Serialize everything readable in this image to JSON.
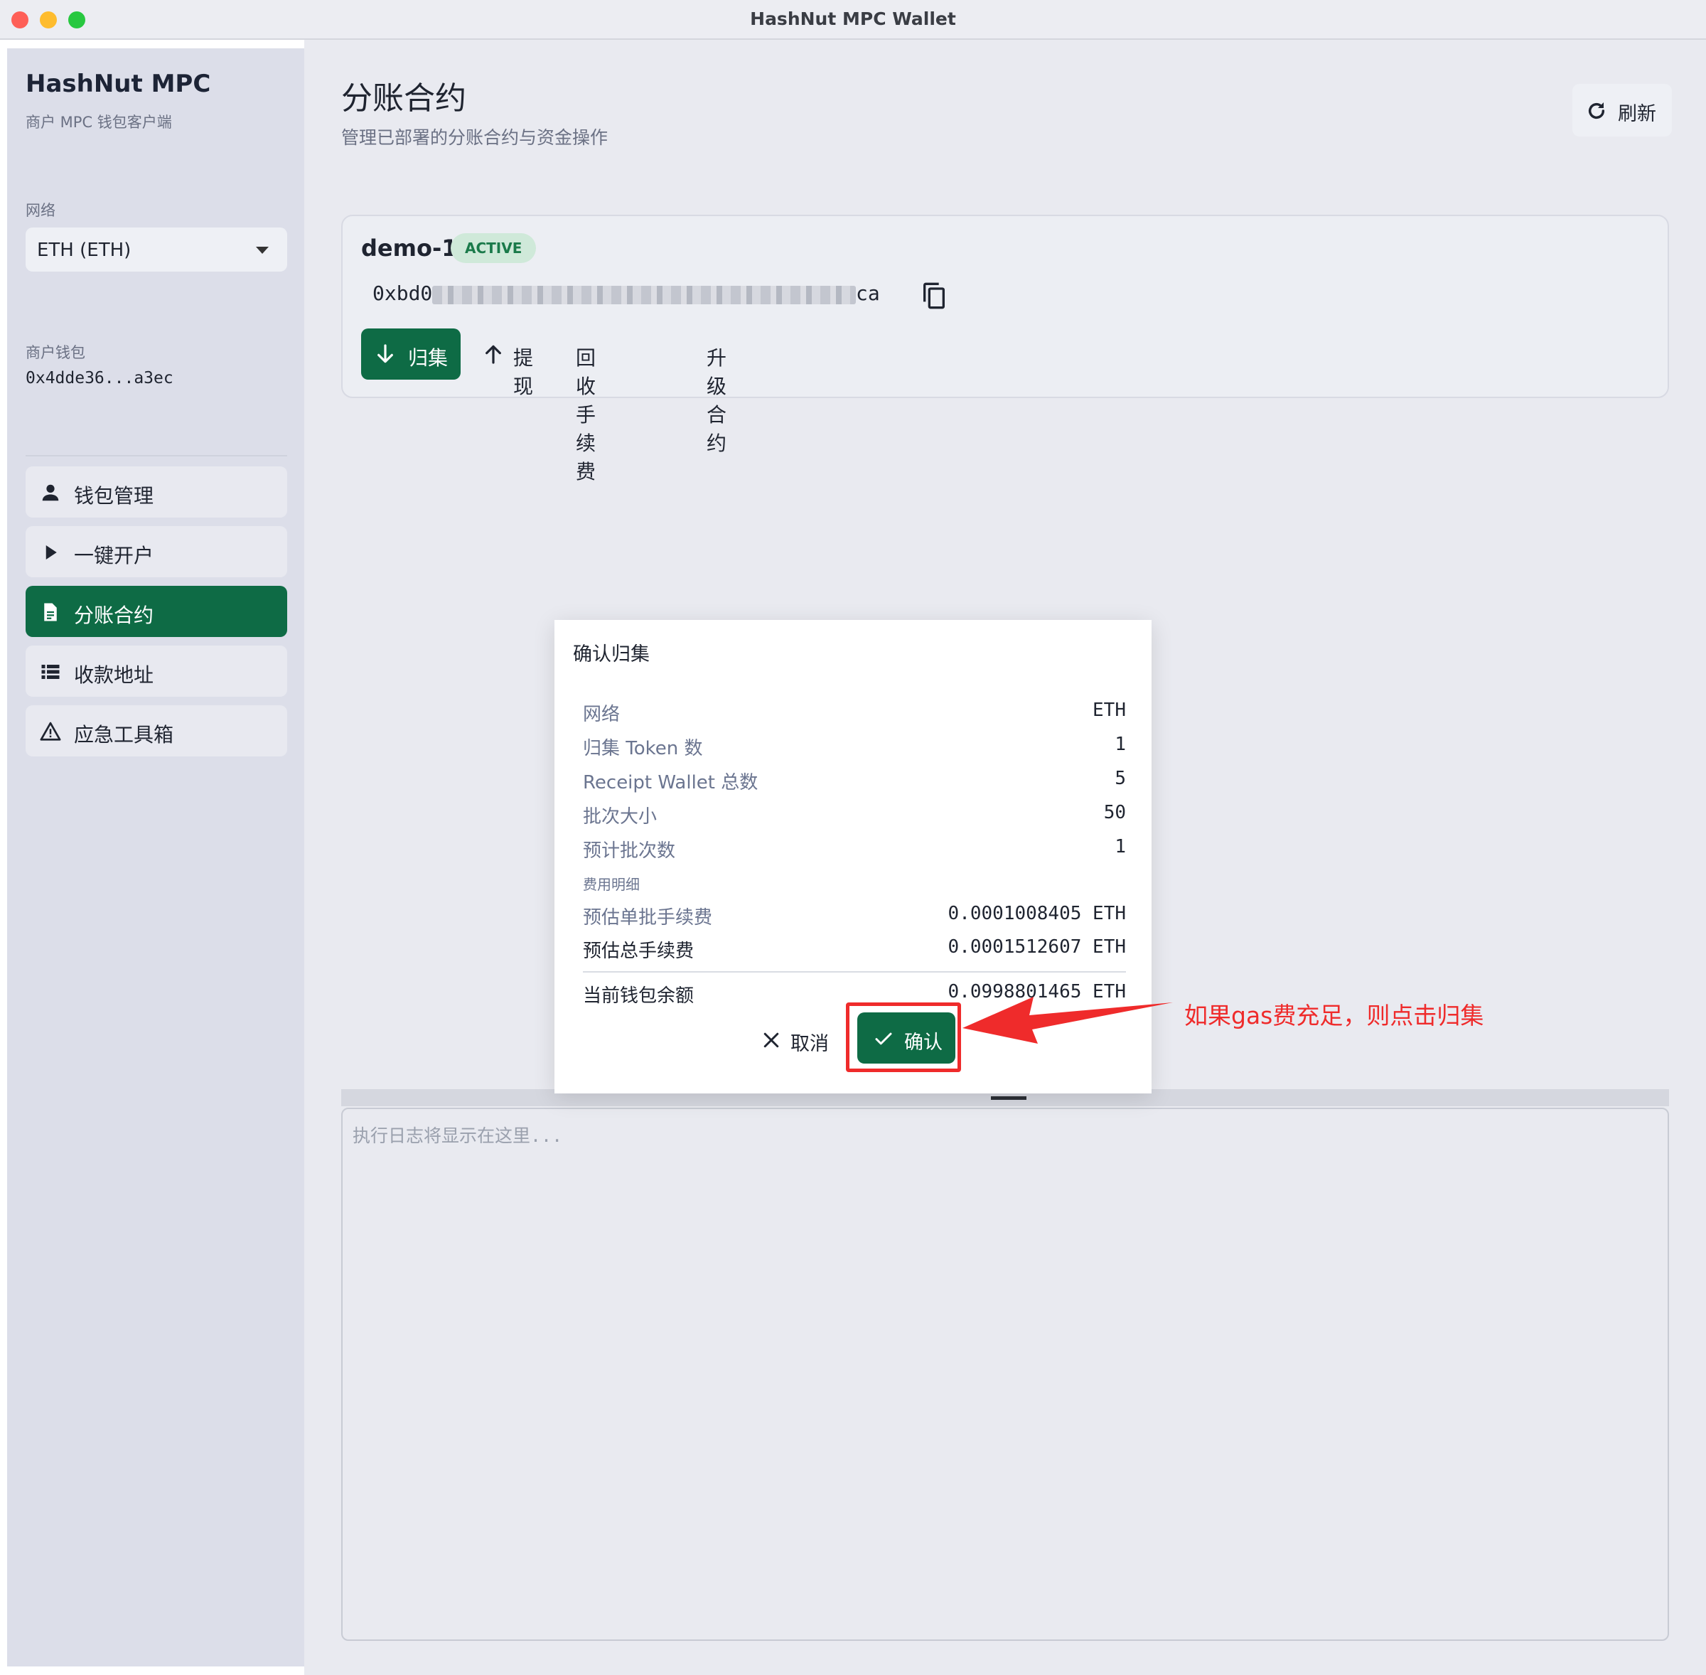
{
  "window": {
    "title": "HashNut MPC Wallet"
  },
  "sidebar": {
    "brand": "HashNut MPC",
    "brand_sub": "商户 MPC 钱包客户端",
    "network_label": "网络",
    "network_value": "ETH (ETH)",
    "wallet_label": "商户钱包",
    "wallet_address": "0x4dde36...a3ec",
    "items": [
      {
        "label": "钱包管理",
        "icon": "person-icon"
      },
      {
        "label": "一键开户",
        "icon": "play-icon"
      },
      {
        "label": "分账合约",
        "icon": "document-icon",
        "active": true
      },
      {
        "label": "收款地址",
        "icon": "list-icon"
      },
      {
        "label": "应急工具箱",
        "icon": "warning-icon"
      }
    ]
  },
  "header": {
    "title": "分账合约",
    "subtitle": "管理已部署的分账合约与资金操作",
    "refresh_label": "刷新"
  },
  "contract": {
    "name": "demo-1",
    "status": "ACTIVE",
    "address_start": "0xbd0",
    "address_end": "ca",
    "actions": {
      "collect": "归集",
      "withdraw": "提现",
      "reclaim_fee": "回收手续费",
      "upgrade": "升级合约"
    }
  },
  "log": {
    "placeholder": "执行日志将显示在这里..."
  },
  "dialog": {
    "title": "确认归集",
    "rows": [
      {
        "key": "网络",
        "value": "ETH"
      },
      {
        "key": "归集 Token 数",
        "value": "1"
      },
      {
        "key": "Receipt Wallet 总数",
        "value": "5"
      },
      {
        "key": "批次大小",
        "value": "50"
      },
      {
        "key": "预计批次数",
        "value": "1"
      }
    ],
    "fee_section": "费用明细",
    "fee_rows": [
      {
        "key": "预估单批手续费",
        "value": "0.0001008405 ETH"
      },
      {
        "key": "预估总手续费",
        "value": "0.0001512607 ETH"
      }
    ],
    "balance": {
      "key": "当前钱包余额",
      "value": "0.0998801465 ETH"
    },
    "cancel_label": "取消",
    "confirm_label": "确认"
  },
  "annotation": {
    "text": "如果gas费充足，则点击归集",
    "color": "#ef2b2b"
  },
  "colors": {
    "accent": "#0e6b45",
    "badge_bg": "#cfe9d9",
    "badge_text": "#1a7a4a"
  }
}
